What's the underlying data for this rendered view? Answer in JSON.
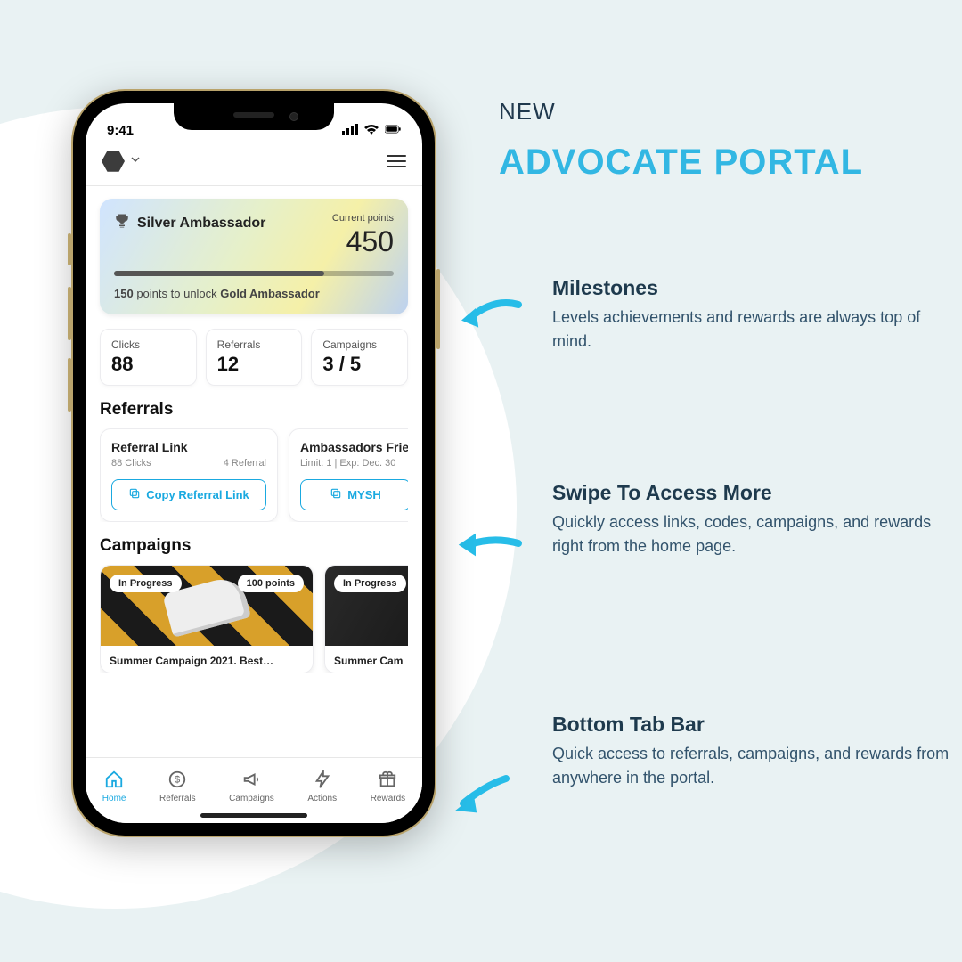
{
  "promo": {
    "badge": "NEW",
    "headline": "ADVOCATE PORTAL",
    "items": [
      {
        "title": "Milestones",
        "desc": "Levels achievements and rewards are always top of mind."
      },
      {
        "title": "Swipe To Access More",
        "desc": "Quickly access links, codes, campaigns, and rewards right from the home page."
      },
      {
        "title": "Bottom Tab Bar",
        "desc": "Quick access to referrals, campaigns, and rewards from anywhere in the portal."
      }
    ]
  },
  "statusbar": {
    "time": "9:41"
  },
  "milestone": {
    "tier": "Silver Ambassador",
    "current_label": "Current points",
    "points": "450",
    "remaining": "150",
    "next_tier": "Gold Ambassador",
    "points_word": "points to unlock"
  },
  "stats": [
    {
      "label": "Clicks",
      "value": "88"
    },
    {
      "label": "Referrals",
      "value": "12"
    },
    {
      "label": "Campaigns",
      "value": "3 / 5"
    }
  ],
  "referrals": {
    "title": "Referrals",
    "cards": [
      {
        "title": "Referral Link",
        "sub_left": "88 Clicks",
        "sub_right": "4 Referral",
        "button": "Copy Referral Link"
      },
      {
        "title": "Ambassadors Frie",
        "sub_left": "Limit: 1 | Exp: Dec. 30",
        "sub_right": "",
        "button": "MYSH"
      }
    ]
  },
  "campaigns": {
    "title": "Campaigns",
    "cards": [
      {
        "status": "In Progress",
        "points": "100 points",
        "title": "Summer Campaign 2021. Best…"
      },
      {
        "status": "In Progress",
        "points": "",
        "title": "Summer Cam"
      }
    ]
  },
  "tabs": [
    {
      "label": "Home",
      "active": true
    },
    {
      "label": "Referrals"
    },
    {
      "label": "Campaigns"
    },
    {
      "label": "Actions"
    },
    {
      "label": "Rewards"
    }
  ]
}
